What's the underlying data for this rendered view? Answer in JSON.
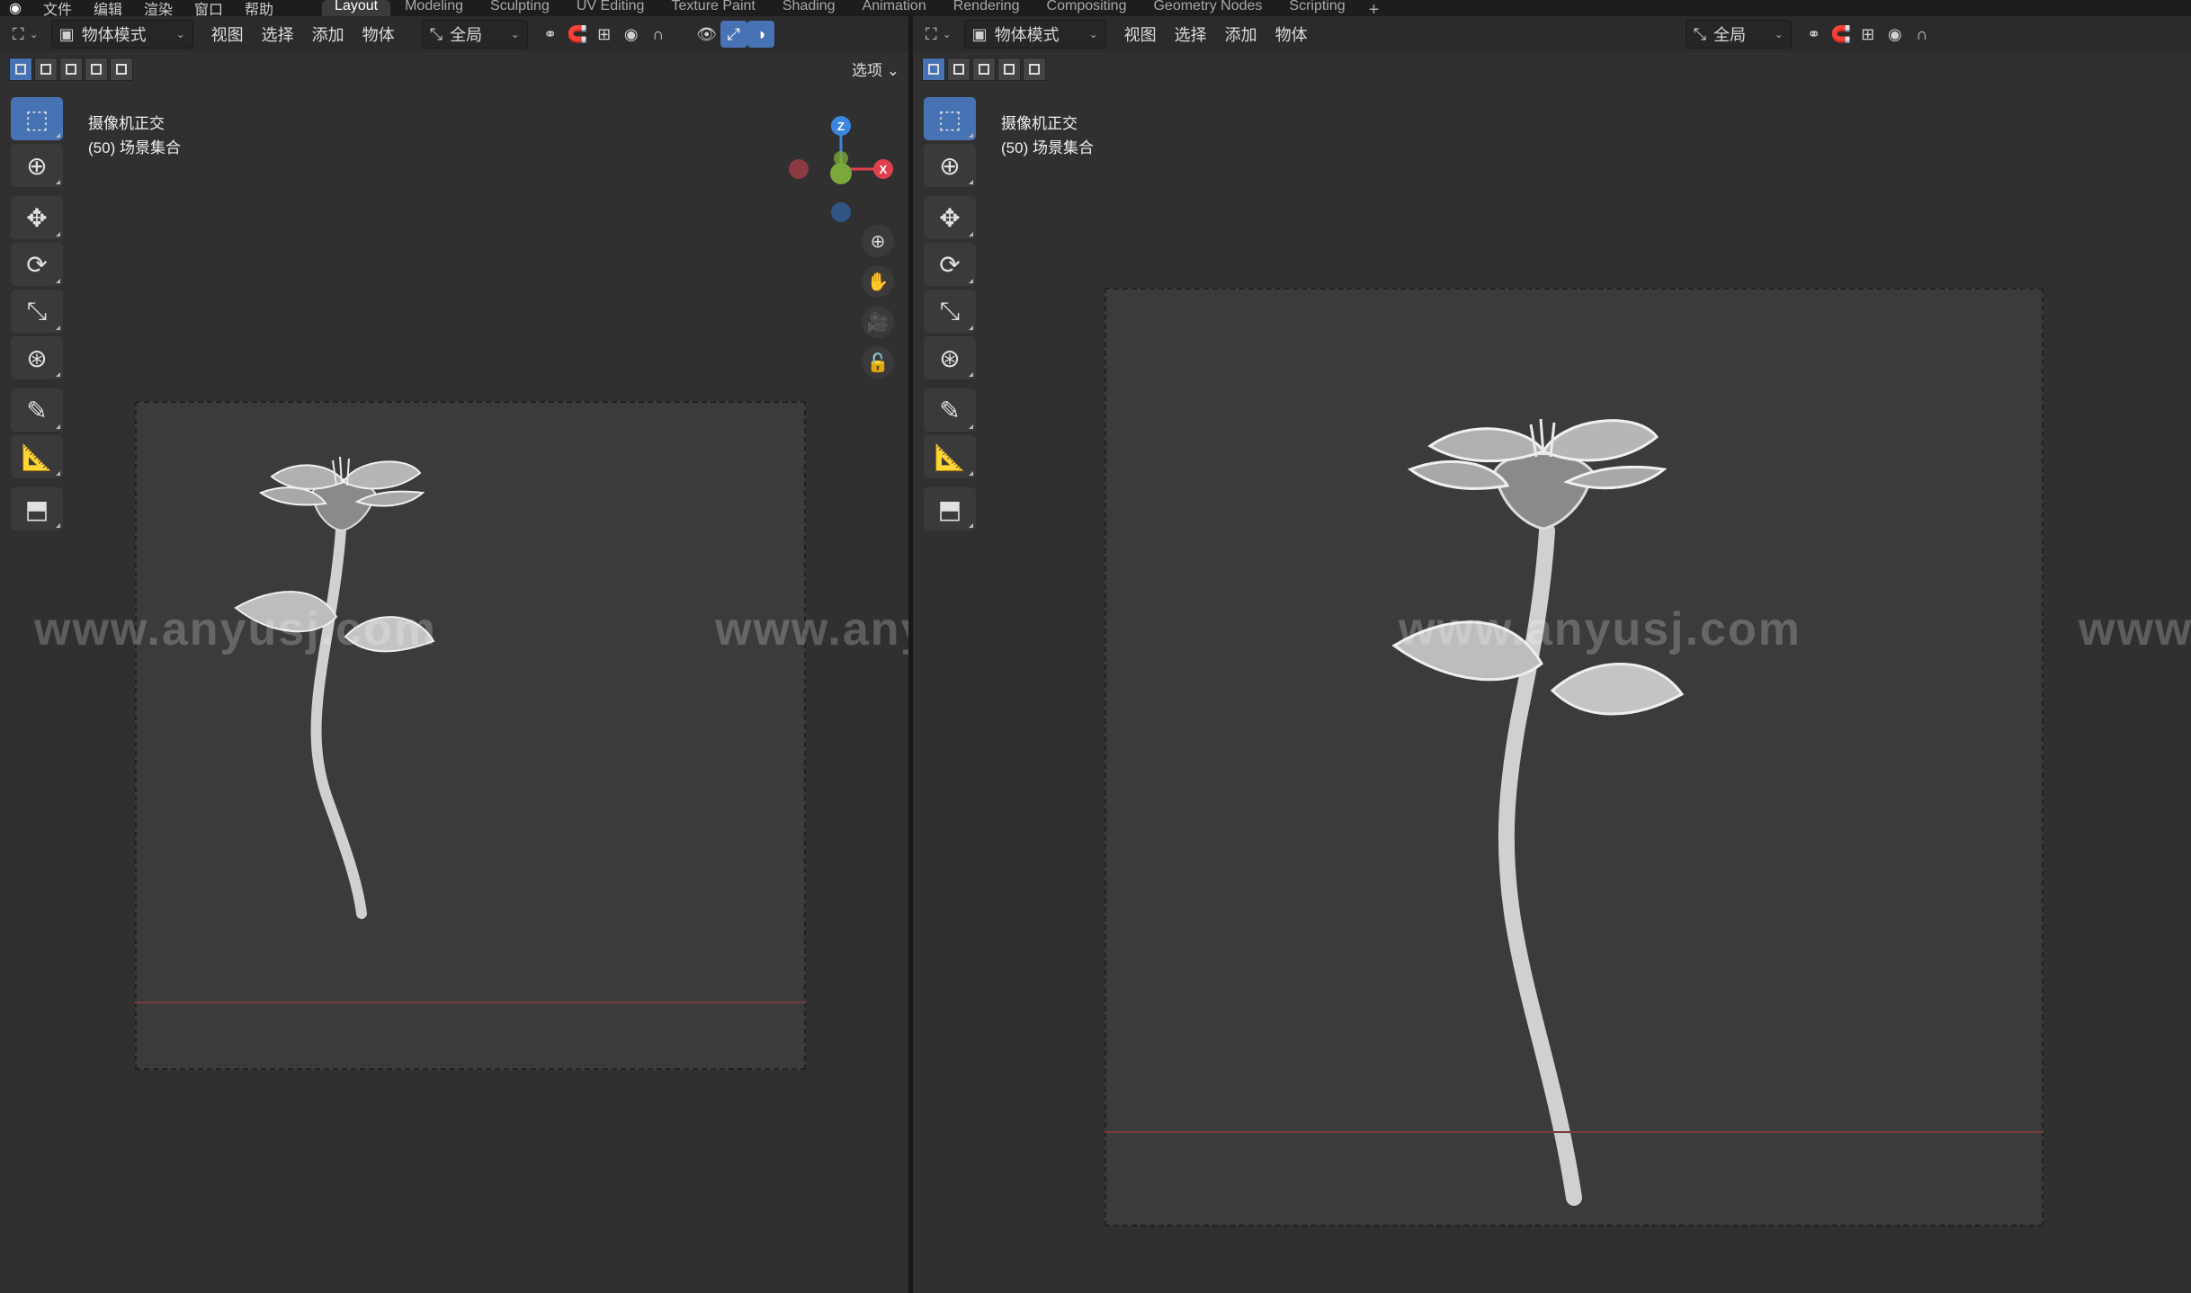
{
  "top_menu": [
    "文件",
    "编辑",
    "渲染",
    "窗口",
    "帮助"
  ],
  "workspace_tabs": [
    {
      "label": "Layout",
      "active": true
    },
    {
      "label": "Modeling",
      "active": false
    },
    {
      "label": "Sculpting",
      "active": false
    },
    {
      "label": "UV Editing",
      "active": false
    },
    {
      "label": "Texture Paint",
      "active": false
    },
    {
      "label": "Shading",
      "active": false
    },
    {
      "label": "Animation",
      "active": false
    },
    {
      "label": "Rendering",
      "active": false
    },
    {
      "label": "Compositing",
      "active": false
    },
    {
      "label": "Geometry Nodes",
      "active": false
    },
    {
      "label": "Scripting",
      "active": false
    }
  ],
  "add_workspace": "+",
  "left_viewport": {
    "mode": "物体模式",
    "menus": [
      "视图",
      "选择",
      "添加",
      "物体"
    ],
    "transform_orientation": "全局",
    "options": "选项",
    "view_name": "摄像机正交",
    "collection": "(50) 场景集合",
    "gizmo_labels": {
      "z": "Z",
      "y": "Y",
      "x": "X"
    }
  },
  "right_viewport": {
    "mode": "物体模式",
    "menus": [
      "视图",
      "选择",
      "添加",
      "物体"
    ],
    "transform_orientation": "全局",
    "view_name": "摄像机正交",
    "collection": "(50) 场景集合"
  },
  "watermarks": [
    "www.anyusj.com",
    "www.anyusj.com",
    "www.anyusj.com",
    "www"
  ],
  "colors": {
    "accent": "#4772b3",
    "gizmo_x": "#e0404a",
    "gizmo_y": "#7aa83a",
    "gizmo_z": "#3b86e0"
  }
}
